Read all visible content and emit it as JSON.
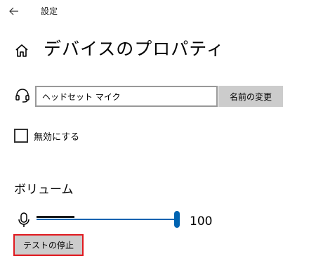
{
  "window": {
    "title": "設定",
    "back_icon": "back-arrow-icon"
  },
  "page": {
    "title": "デバイスのプロパティ",
    "home_icon": "home-icon"
  },
  "device_name": {
    "icon": "headset-icon",
    "value": "ヘッドセット マイク",
    "rename_button_label": "名前の変更"
  },
  "disable_option": {
    "label": "無効にする",
    "checked": false
  },
  "volume": {
    "heading": "ボリューム",
    "icon": "microphone-icon",
    "value": "100",
    "slider_level": 100,
    "accent_color": "#0063b1",
    "test_button_label": "テストの停止",
    "test_button_highlight_color": "#e0191f"
  }
}
